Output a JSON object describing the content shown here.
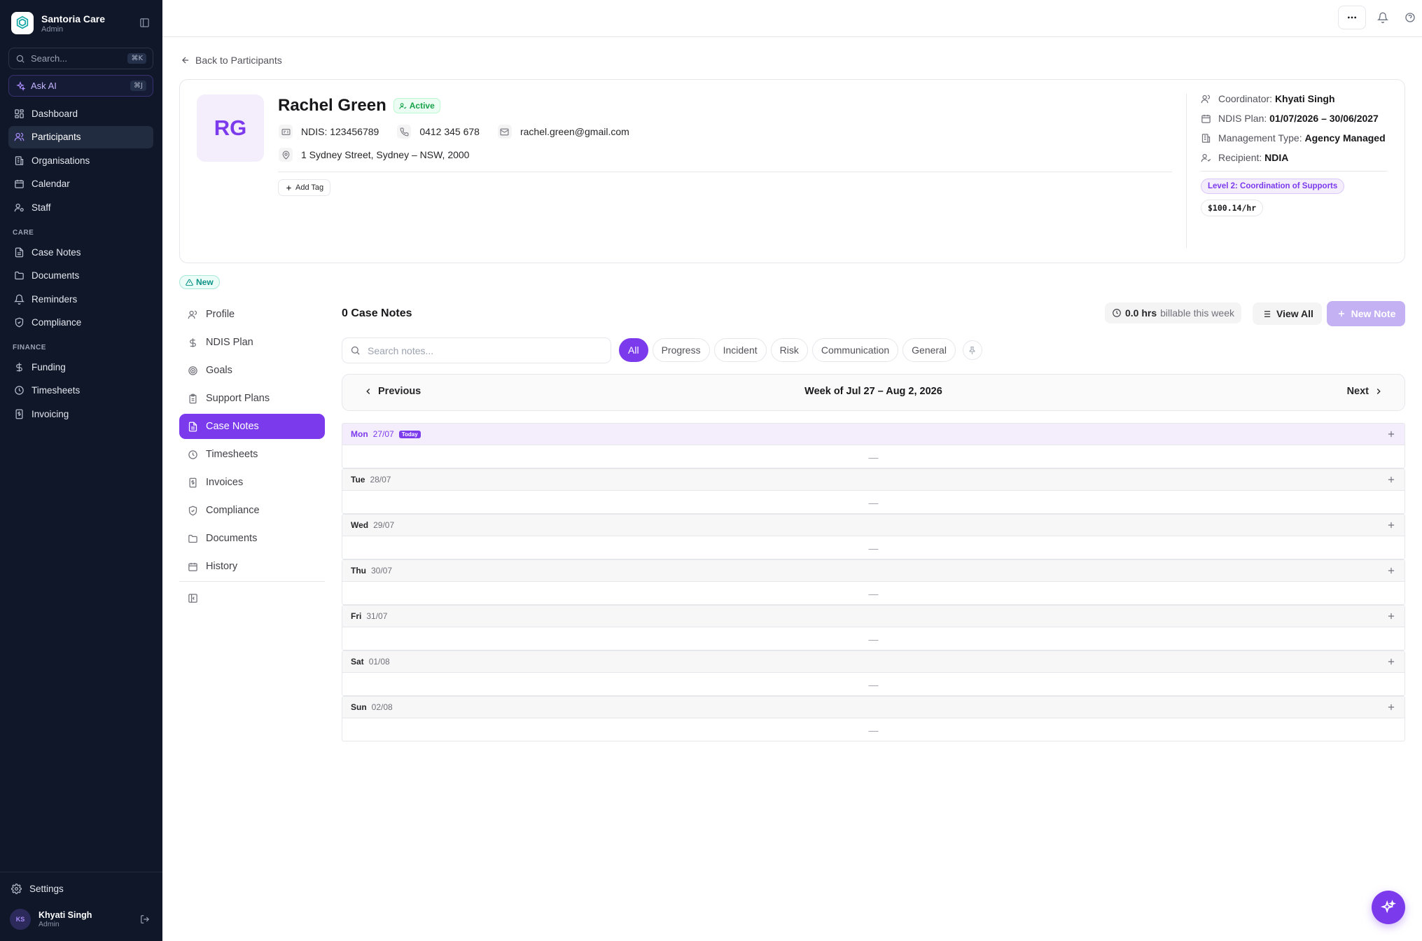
{
  "sidebar": {
    "org_name": "Santoria Care",
    "org_role": "Admin",
    "search_placeholder": "Search...",
    "search_shortcut": "⌘K",
    "ask_ai_label": "Ask AI",
    "ask_ai_shortcut": "⌘J",
    "main_items": [
      {
        "label": "Dashboard",
        "icon": "dashboard-icon"
      },
      {
        "label": "Participants",
        "icon": "users-icon",
        "active": true
      },
      {
        "label": "Organisations",
        "icon": "building-icon"
      },
      {
        "label": "Calendar",
        "icon": "calendar-icon"
      },
      {
        "label": "Staff",
        "icon": "user-cog-icon"
      }
    ],
    "care_section": "CARE",
    "care_items": [
      {
        "label": "Case Notes",
        "icon": "file-text-icon"
      },
      {
        "label": "Documents",
        "icon": "folder-icon"
      },
      {
        "label": "Reminders",
        "icon": "bell-icon"
      },
      {
        "label": "Compliance",
        "icon": "shield-check-icon"
      }
    ],
    "finance_section": "FINANCE",
    "finance_items": [
      {
        "label": "Funding",
        "icon": "dollar-icon"
      },
      {
        "label": "Timesheets",
        "icon": "clock-icon"
      },
      {
        "label": "Invoicing",
        "icon": "receipt-icon"
      }
    ],
    "settings_label": "Settings",
    "user": {
      "initials": "KS",
      "name": "Khyati Singh",
      "role": "Admin"
    }
  },
  "topbar": {
    "more_icon": "more-horizontal-icon",
    "bell_icon": "bell-icon",
    "help_icon": "help-circle-icon"
  },
  "back_link": "Back to Participants",
  "participant": {
    "initials": "RG",
    "name": "Rachel Green",
    "status": "Active",
    "ndis": "NDIS: 123456789",
    "phone": "0412 345 678",
    "email": "rachel.green@gmail.com",
    "address": "1 Sydney Street, Sydney – NSW, 2000",
    "add_tag_label": "Add Tag",
    "coordinator_label": "Coordinator:",
    "coordinator_value": "Khyati Singh",
    "plan_label": "NDIS Plan:",
    "plan_value": "01/07/2026 – 30/06/2027",
    "management_label": "Management Type:",
    "management_value": "Agency Managed",
    "recipient_label": "Recipient:",
    "recipient_value": "NDIA",
    "support_level": "Level 2: Coordination of Supports",
    "rate": "$100.14/hr"
  },
  "new_badge": "New",
  "subnav": [
    {
      "label": "Profile",
      "icon": "user-icon"
    },
    {
      "label": "NDIS Plan",
      "icon": "dollar-icon"
    },
    {
      "label": "Goals",
      "icon": "target-icon"
    },
    {
      "label": "Support Plans",
      "icon": "clipboard-icon"
    },
    {
      "label": "Case Notes",
      "icon": "file-text-icon",
      "active": true
    },
    {
      "label": "Timesheets",
      "icon": "clock-icon"
    },
    {
      "label": "Invoices",
      "icon": "receipt-icon"
    },
    {
      "label": "Compliance",
      "icon": "shield-check-icon"
    },
    {
      "label": "Documents",
      "icon": "folder-icon"
    },
    {
      "label": "History",
      "icon": "calendar-icon"
    }
  ],
  "notes": {
    "title": "0 Case Notes",
    "billable_value": "0.0 hrs",
    "billable_text": "billable this week",
    "view_all_label": "View All",
    "new_note_label": "New Note",
    "search_placeholder": "Search notes...",
    "filters": [
      "All",
      "Progress",
      "Incident",
      "Risk",
      "Communication",
      "General"
    ],
    "active_filter": "All",
    "prev_label": "Previous",
    "next_label": "Next",
    "week_label": "Week of Jul 27 – Aug 2, 2026",
    "today_label": "Today",
    "empty_marker": "—",
    "days": [
      {
        "name": "Mon",
        "date": "27/07",
        "today": true
      },
      {
        "name": "Tue",
        "date": "28/07"
      },
      {
        "name": "Wed",
        "date": "29/07"
      },
      {
        "name": "Thu",
        "date": "30/07"
      },
      {
        "name": "Fri",
        "date": "31/07"
      },
      {
        "name": "Sat",
        "date": "01/08"
      },
      {
        "name": "Sun",
        "date": "02/08"
      }
    ]
  },
  "colors": {
    "accent": "#7c3aed",
    "sidebar_bg": "#0f1729",
    "active_green": "#16a34a"
  }
}
